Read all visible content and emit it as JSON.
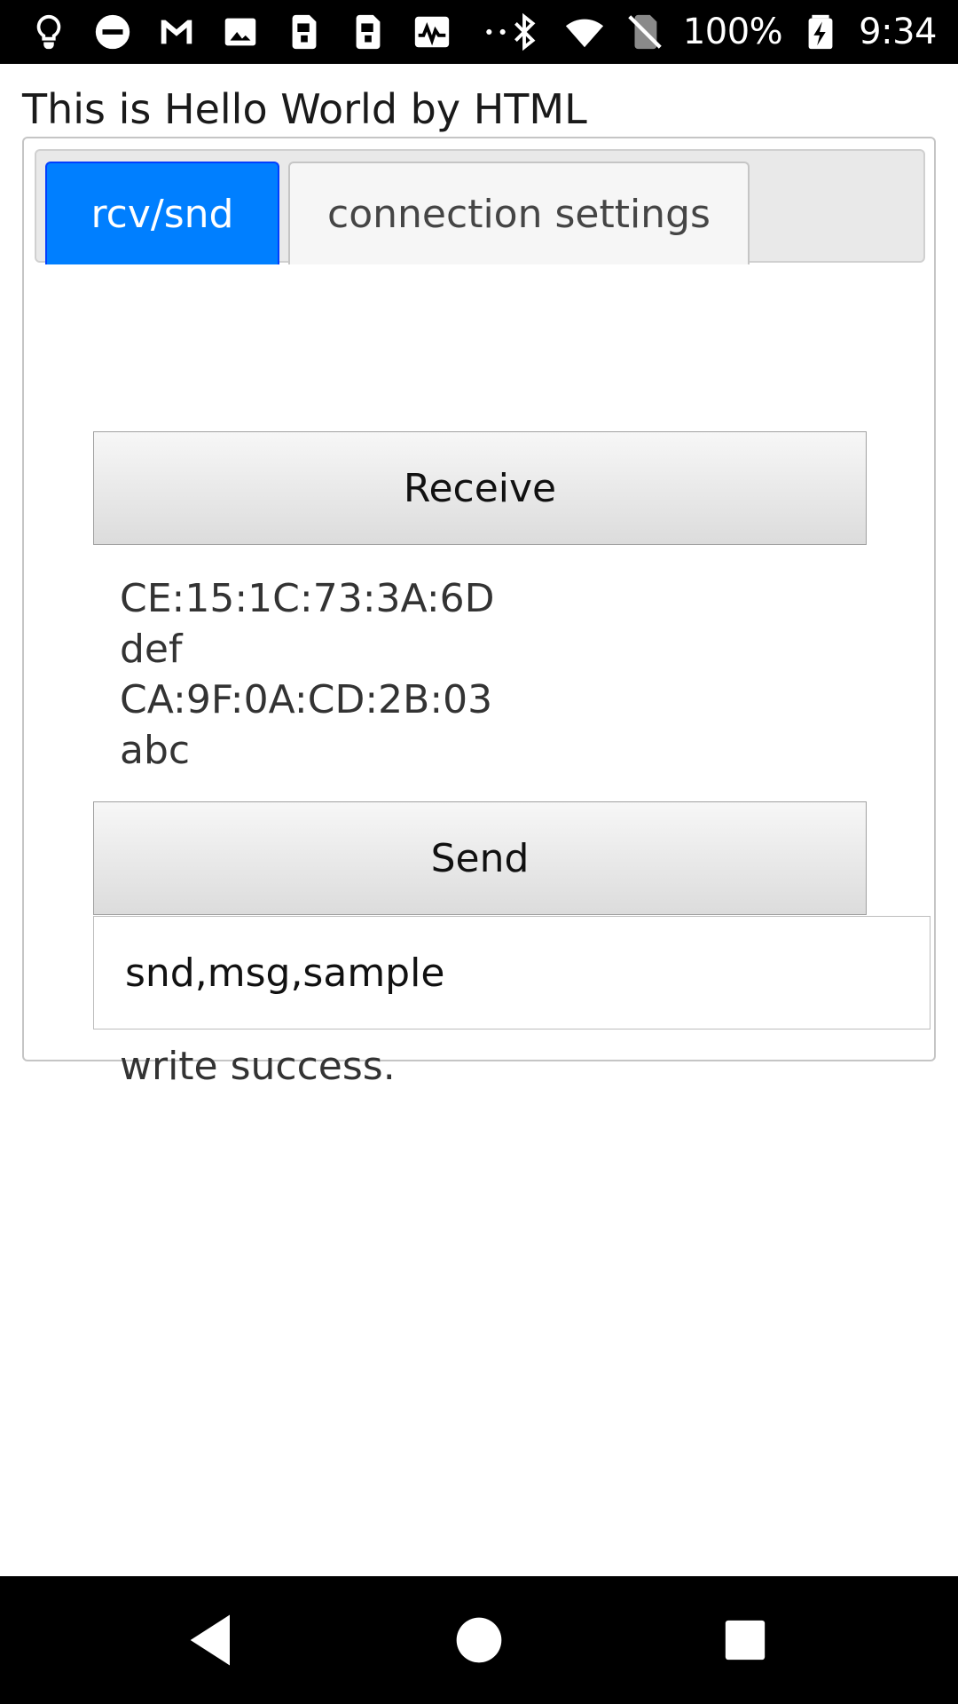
{
  "status_bar": {
    "battery_text": "100%",
    "time": "9:34",
    "left_icons": [
      "lightbulb-icon",
      "do-not-disturb-icon",
      "gmail-icon",
      "image-icon",
      "sim-card-icon",
      "sim-card-icon",
      "activity-graph-icon",
      "more-dots-icon"
    ],
    "right_icons": [
      "bluetooth-icon",
      "wifi-icon",
      "no-sim-icon",
      "battery-charging-icon"
    ]
  },
  "page": {
    "title": "This is Hello World by HTML"
  },
  "tabs": {
    "active_label": "rcv/snd",
    "inactive_label": "connection settings"
  },
  "panel": {
    "receive_label": "Receive",
    "received_lines": [
      "CE:15:1C:73:3A:6D",
      "def",
      "CA:9F:0A:CD:2B:03",
      "abc"
    ],
    "send_label": "Send",
    "message_value": "snd,msg,sample",
    "status_message": "write success."
  },
  "colors": {
    "active_tab": "#007fff",
    "active_tab_border": "#003eff",
    "status_bar_bg": "#000000"
  },
  "nav_bar": {
    "icons": [
      "back-icon",
      "home-icon",
      "recents-icon"
    ]
  }
}
